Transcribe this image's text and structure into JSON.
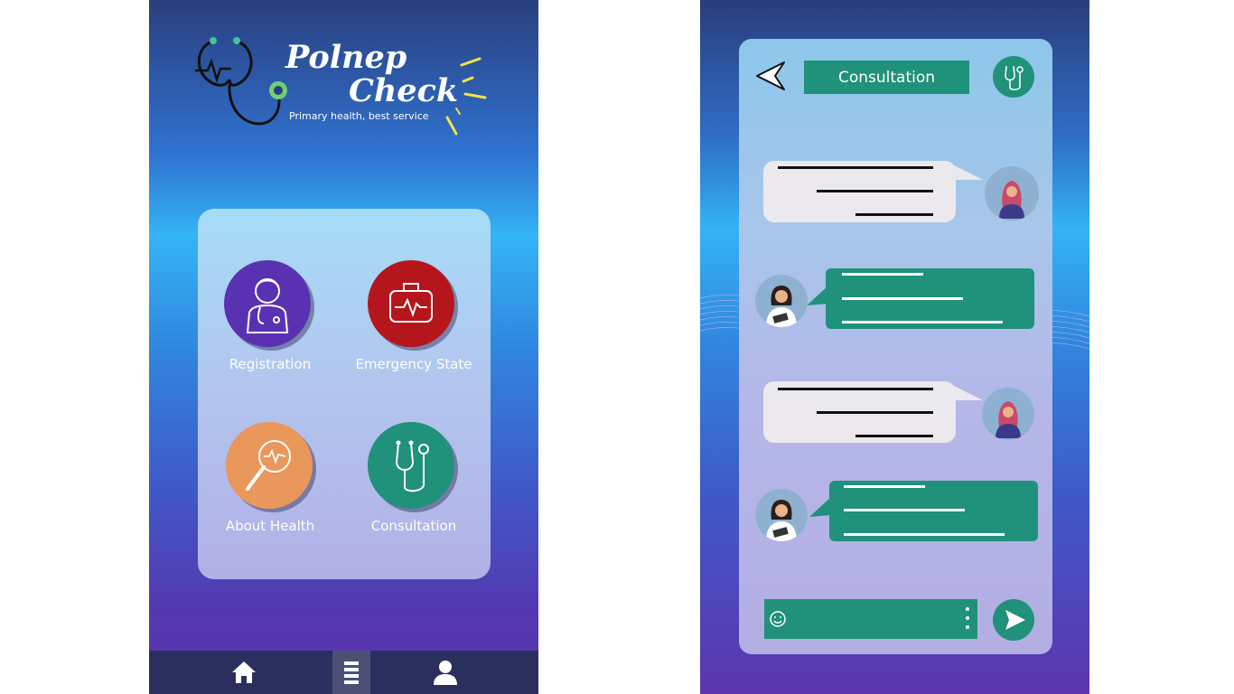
{
  "home": {
    "app_name_line1": "Polnep",
    "app_name_line2": "Check",
    "tagline": "Primary health, best service",
    "tiles": [
      {
        "label": "Registration",
        "color": "#5a31b2",
        "icon": "doctor-icon"
      },
      {
        "label": "Emergency State",
        "color": "#b5161b",
        "icon": "first-aid-kit-icon"
      },
      {
        "label": "About Health",
        "color": "#e9975a",
        "icon": "magnifier-icon"
      },
      {
        "label": "Consultation",
        "color": "#20917a",
        "icon": "stethoscope-icon"
      }
    ],
    "nav": [
      {
        "icon": "home-icon"
      },
      {
        "icon": "menu-icon"
      },
      {
        "icon": "user-icon"
      }
    ]
  },
  "chat": {
    "title": "Consultation",
    "back_icon": "back-arrow-icon",
    "header_icon": "stethoscope-icon",
    "messages": [
      {
        "from": "patient",
        "bubble_color": "#ece9ee"
      },
      {
        "from": "doctor",
        "bubble_color": "#20917a"
      },
      {
        "from": "patient",
        "bubble_color": "#ece9ee"
      },
      {
        "from": "doctor",
        "bubble_color": "#20917a"
      }
    ],
    "input": {
      "emoji_icon": "emoji-icon",
      "more_icon": "more-vertical-icon"
    },
    "send_icon": "send-icon"
  }
}
